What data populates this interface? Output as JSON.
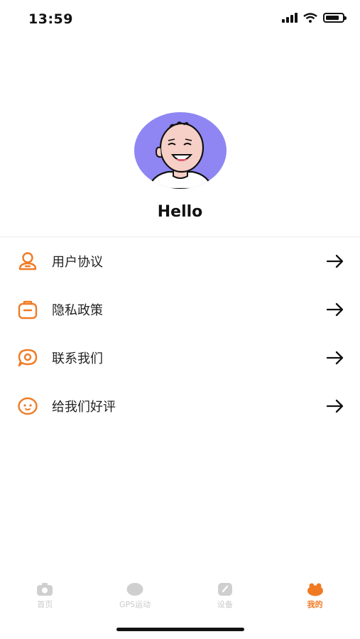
{
  "status": {
    "time": "13:59"
  },
  "profile": {
    "greeting": "Hello"
  },
  "menu": [
    {
      "label": "用户协议",
      "icon": "user-icon"
    },
    {
      "label": "隐私政策",
      "icon": "clipboard-icon"
    },
    {
      "label": "联系我们",
      "icon": "chat-bubble-icon"
    },
    {
      "label": "给我们好评",
      "icon": "smiley-icon"
    }
  ],
  "tabs": [
    {
      "label": "首页",
      "icon": "camera-icon",
      "active": false
    },
    {
      "label": "GPS运动",
      "icon": "cloud-icon",
      "active": false
    },
    {
      "label": "设备",
      "icon": "device-icon",
      "active": false
    },
    {
      "label": "我的",
      "icon": "profile-icon",
      "active": true
    }
  ],
  "colors": {
    "accent": "#f07a24",
    "avatar_bg": "#8f86f4",
    "inactive_tab": "#c9c9c9"
  }
}
